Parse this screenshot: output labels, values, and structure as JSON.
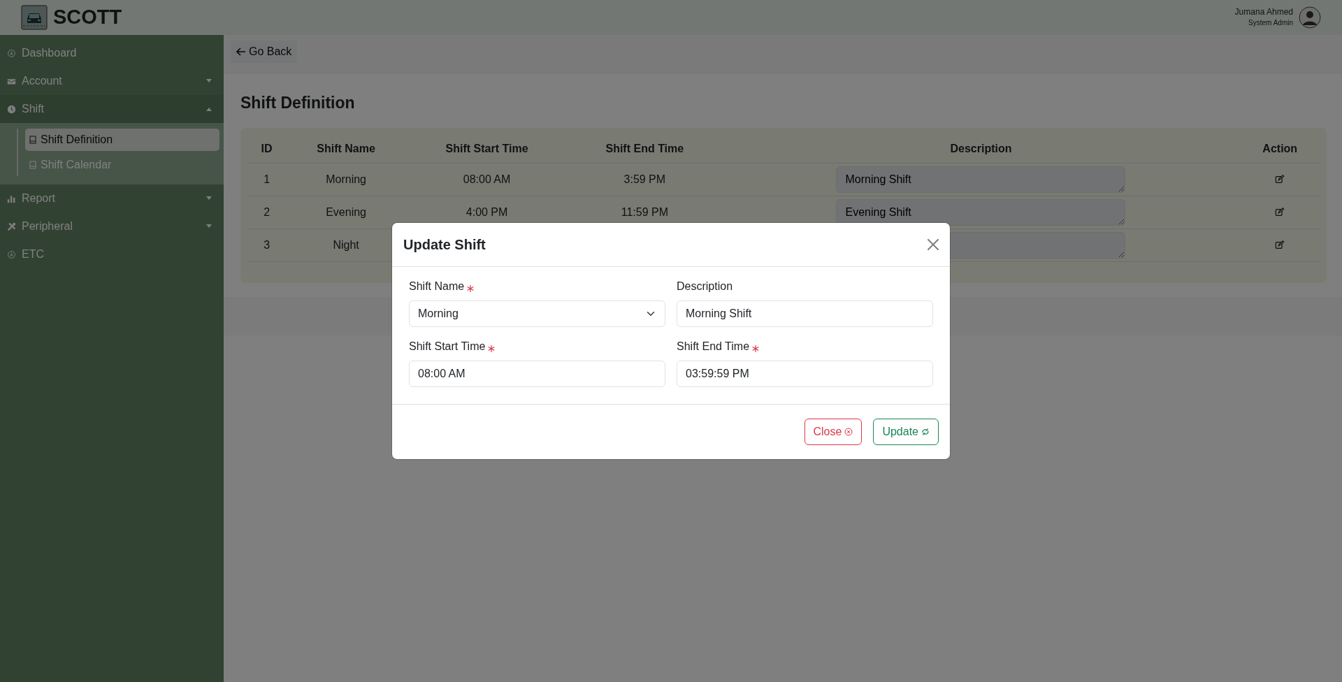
{
  "brand": {
    "name": "SCOTT"
  },
  "user": {
    "name": "Jumana Ahmed",
    "role": "System Admin"
  },
  "sidebar": {
    "items": [
      {
        "kind": "link",
        "label": "Dashboard"
      },
      {
        "kind": "group",
        "label": "Account",
        "expanded": false
      },
      {
        "kind": "group",
        "label": "Shift",
        "expanded": true,
        "children": [
          {
            "label": "Shift Definition",
            "selected": true
          },
          {
            "label": "Shift Calendar",
            "selected": false
          }
        ]
      },
      {
        "kind": "group",
        "label": "Report",
        "expanded": false
      },
      {
        "kind": "group",
        "label": "Peripheral",
        "expanded": false
      },
      {
        "kind": "link",
        "label": "ETC"
      }
    ]
  },
  "back_button": {
    "label": "Go Back"
  },
  "page_title": "Shift Definition",
  "table": {
    "columns": [
      "ID",
      "Shift Name",
      "Shift Start Time",
      "Shift End Time",
      "Description",
      "Action"
    ],
    "rows": [
      {
        "id": "1",
        "name": "Morning",
        "start": "08:00 AM",
        "end": "3:59 PM",
        "description": "Morning Shift"
      },
      {
        "id": "2",
        "name": "Evening",
        "start": "4:00 PM",
        "end": "11:59 PM",
        "description": "Evening Shift"
      },
      {
        "id": "3",
        "name": "Night"
      }
    ]
  },
  "modal": {
    "title": "Update Shift",
    "fields": [
      {
        "kind": "select",
        "label": "Shift Name",
        "required": true,
        "value": "Morning"
      },
      {
        "kind": "text",
        "label": "Description",
        "required": false,
        "value": "Morning Shift"
      },
      {
        "kind": "text",
        "label": "Shift Start Time",
        "required": true,
        "value": "08:00 AM"
      },
      {
        "kind": "text",
        "label": "Shift End Time",
        "required": true,
        "value": "03:59:59 PM"
      }
    ],
    "buttons": [
      {
        "kind": "close",
        "label": "Close"
      },
      {
        "kind": "update",
        "label": "Update"
      }
    ]
  }
}
